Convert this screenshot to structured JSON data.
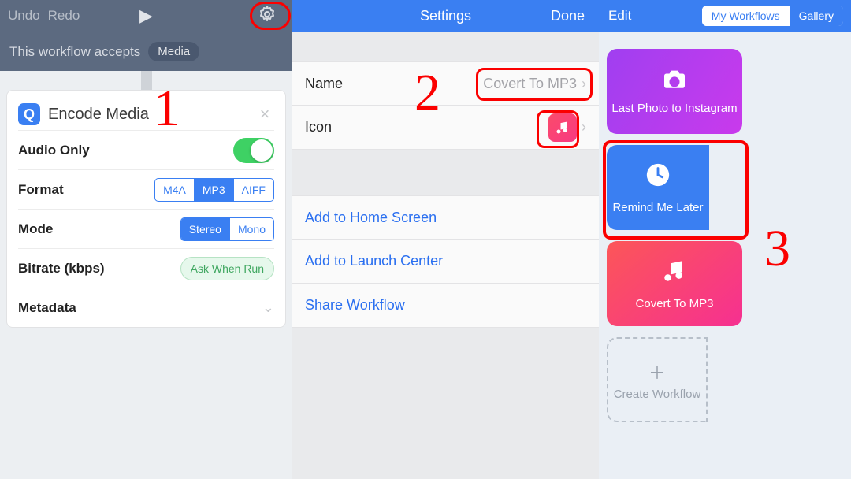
{
  "col1": {
    "undo": "Undo",
    "redo": "Redo",
    "accepts": "This workflow accepts",
    "accepts_pill": "Media",
    "card": {
      "title": "Encode Media",
      "rows": {
        "audio_only": "Audio Only",
        "format": "Format",
        "mode": "Mode",
        "bitrate": "Bitrate (kbps)",
        "metadata": "Metadata"
      },
      "format_opts": [
        "M4A",
        "MP3",
        "AIFF"
      ],
      "format_active": "MP3",
      "mode_opts": [
        "Stereo",
        "Mono"
      ],
      "mode_active": "Stereo",
      "bitrate_btn": "Ask When Run"
    }
  },
  "col2": {
    "title": "Settings",
    "done": "Done",
    "name_label": "Name",
    "name_value": "Covert To MP3",
    "icon_label": "Icon",
    "links": {
      "home": "Add to Home Screen",
      "launch": "Add to Launch Center",
      "share": "Share Workflow"
    }
  },
  "col3": {
    "edit": "Edit",
    "seg": {
      "my": "My Workflows",
      "gallery": "Gallery"
    },
    "tiles": {
      "lastphoto": "Last Photo to Instagram",
      "remind": "Remind Me Later",
      "convert": "Covert To MP3",
      "create": "Create Workflow"
    }
  },
  "annotations": {
    "n1": "1",
    "n2": "2",
    "n3": "3"
  }
}
